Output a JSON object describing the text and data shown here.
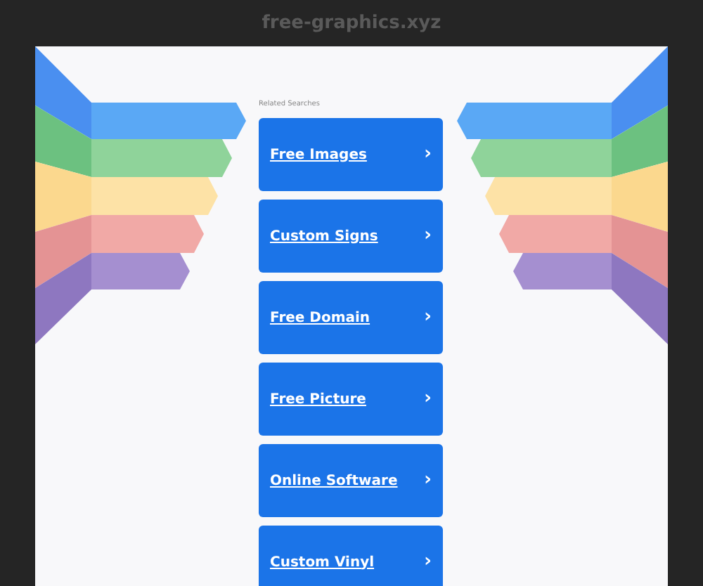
{
  "window": {
    "title": "free-graphics.xyz"
  },
  "section_label": "Related Searches",
  "links": [
    {
      "label": "Free Images",
      "arrow": "›"
    },
    {
      "label": "Custom Signs",
      "arrow": "›"
    },
    {
      "label": "Free Domain",
      "arrow": "›"
    },
    {
      "label": "Free Picture",
      "arrow": "›"
    },
    {
      "label": "Online Software",
      "arrow": "›"
    },
    {
      "label": "Custom Vinyl",
      "arrow": "›"
    }
  ]
}
